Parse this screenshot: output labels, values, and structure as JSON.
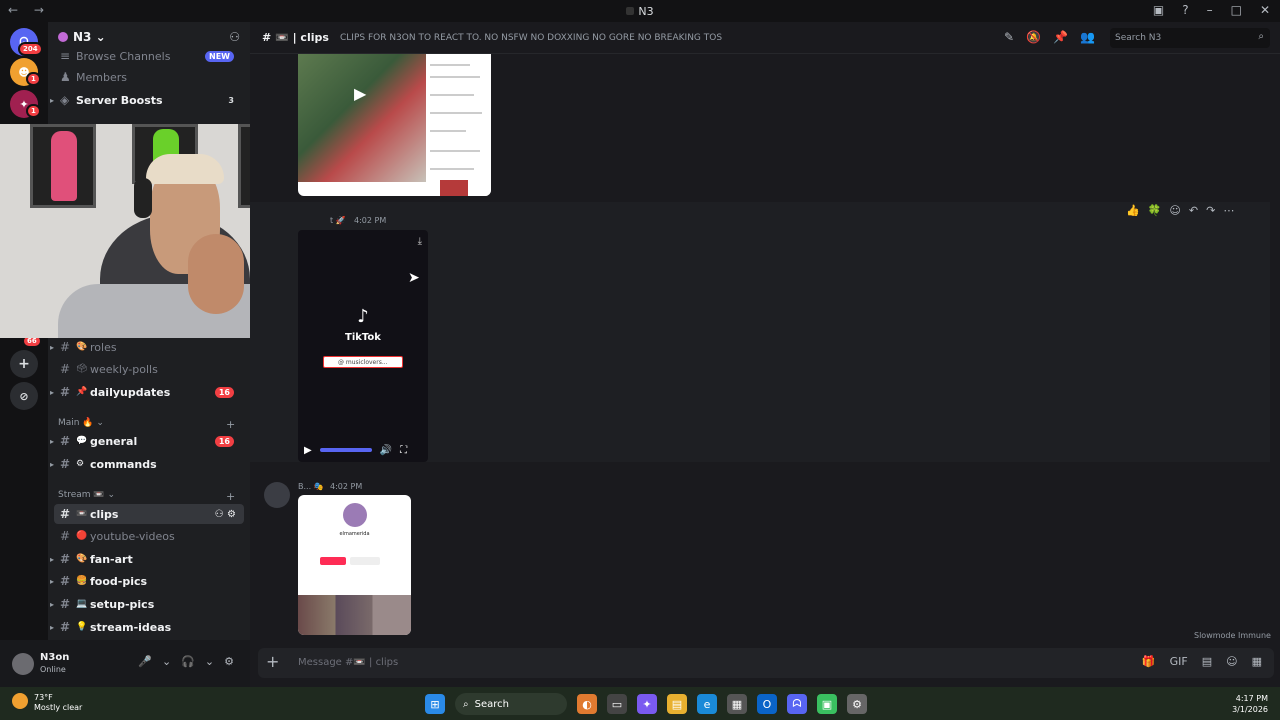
{
  "window": {
    "title": "N3",
    "nav": "← →",
    "controls": [
      "▣",
      "?",
      "–",
      "□",
      "✕"
    ]
  },
  "guilds": [
    {
      "label": "ᗣ",
      "color": "#5865f2",
      "badge": "204"
    },
    {
      "label": "☻",
      "color": "#f0a030",
      "badge": "1"
    },
    {
      "label": "✦",
      "color": "#a02050",
      "badge": "1"
    }
  ],
  "guild_actions": {
    "add": "+",
    "explore": "⊘",
    "badge_bottom": "66"
  },
  "server": {
    "name": "N3",
    "chevron": "⌄",
    "invite_icon": "person-add-icon",
    "invite_glyph": "⚇"
  },
  "top_items": [
    {
      "label": "Browse Channels",
      "badge": "NEW"
    },
    {
      "label": "Members"
    },
    {
      "label": "Server Boosts",
      "count": "3"
    }
  ],
  "channels_upper": [
    {
      "label": "roles",
      "emoji": "🎨",
      "muted": true
    },
    {
      "label": "weekly-polls",
      "emoji": "🗳",
      "muted": true
    },
    {
      "label": "dailyupdates",
      "emoji": "📌",
      "count": "16",
      "unread": true
    }
  ],
  "categories": {
    "main": "Main 🔥 ⌄",
    "stream": "Stream 📼 ⌄",
    "plus": "+"
  },
  "channels_main": [
    {
      "label": "general",
      "emoji": "💬",
      "count": "16",
      "unread": true
    },
    {
      "label": "commands",
      "emoji": "⚙",
      "unread": true
    }
  ],
  "channels_stream": [
    {
      "label": "clips",
      "emoji": "📼",
      "selected": true
    },
    {
      "label": "youtube-videos",
      "emoji": "🔴",
      "muted": true
    },
    {
      "label": "fan-art",
      "emoji": "🎨",
      "unread": true
    },
    {
      "label": "food-pics",
      "emoji": "🍔",
      "unread": true
    },
    {
      "label": "setup-pics",
      "emoji": "💻",
      "unread": true
    },
    {
      "label": "stream-ideas",
      "emoji": "💡",
      "unread": true
    }
  ],
  "user": {
    "name": "N3on",
    "status": "Online",
    "mic": "🎤",
    "headset": "🎧",
    "settings": "⚙",
    "chev": "⌄"
  },
  "channel_header": {
    "name": "📼 | clips",
    "topic": "CLIPS FOR N3ON TO REACT TO. NO NSFW NO DOXXING NO GORE NO BREAKING TOS",
    "search_placeholder": "Search N3",
    "icons": [
      "✎",
      "🔕",
      "📌",
      "👥"
    ]
  },
  "messages": [
    {
      "time": "4:02 PM",
      "author_fragment": "t 🚀"
    },
    {
      "time": "4:02 PM",
      "author_fragment": "B... 🎭"
    }
  ],
  "tiktok": {
    "brand": "TikTok",
    "logo": "♪",
    "search_text": "@ musiclovers..."
  },
  "profile_card": {
    "username": "elmamerida"
  },
  "reactions": [
    "👍",
    "🍀",
    "☺",
    "↶",
    "↷",
    "⋯"
  ],
  "composer": {
    "placeholder": "Message #📼 | clips",
    "plus": "+",
    "icons": [
      "🎁",
      "GIF",
      "▤",
      "☺",
      "▦"
    ]
  },
  "slowmode": "Slowmode Immune",
  "taskbar": {
    "temp": "73°F",
    "weather": "Mostly clear",
    "search": "Search",
    "time": "4:17 PM",
    "date": "3/1/2026"
  }
}
